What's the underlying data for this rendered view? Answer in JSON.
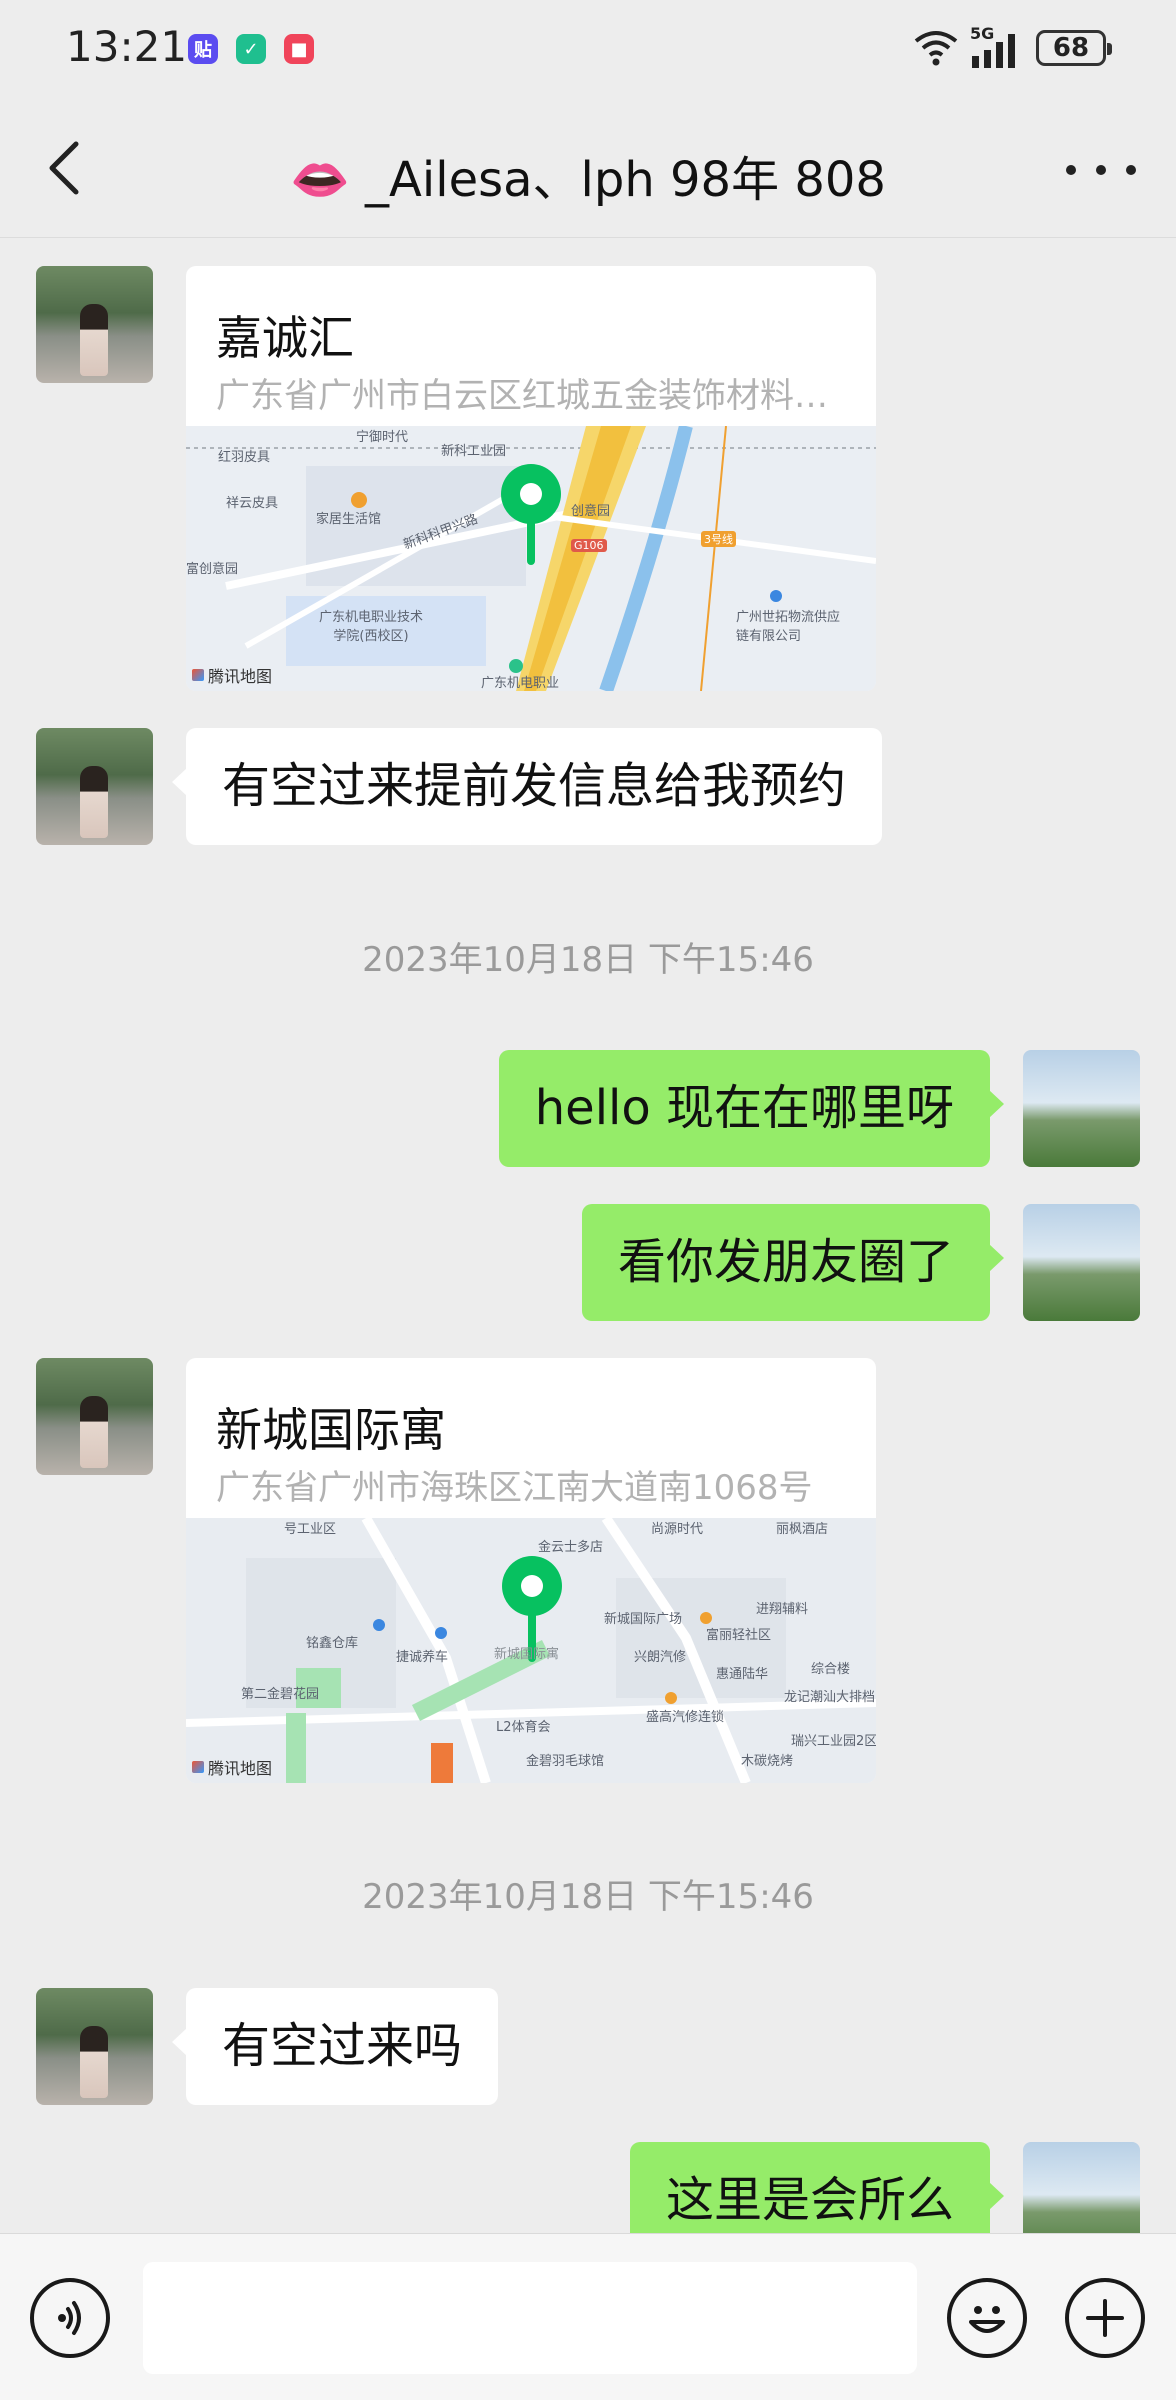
{
  "status_bar": {
    "time": "13:21",
    "app_icons": [
      {
        "name": "tieba-app-icon",
        "glyph": "贴",
        "color": "#5b4cf0"
      },
      {
        "name": "shield-app-icon",
        "glyph": "✓",
        "color": "#1fbf8f"
      },
      {
        "name": "red-app-icon",
        "glyph": "■",
        "color": "#f0445a"
      }
    ],
    "network": "5G",
    "battery": "68"
  },
  "header": {
    "title": "👄 _Ailesa、lph 98年 808"
  },
  "messages": [
    {
      "type": "location",
      "side": "left",
      "name": "嘉诚汇",
      "address": "广东省广州市白云区红城五金装饰材料…",
      "map_brand": "腾讯地图",
      "map_labels": [
        "宁御时代",
        "新科工业园",
        "红羽皮具",
        "祥云皮具",
        "家居生活馆",
        "创意园",
        "G106",
        "新科科甲兴路",
        "富创意园",
        "广东机电职业技术学院(西校区)",
        "广州世拓物流供应链有限公司",
        "广东机电职业",
        "3号线"
      ]
    },
    {
      "type": "text",
      "side": "left",
      "text": "有空过来提前发信息给我预约"
    },
    {
      "type": "timestamp",
      "text": "2023年10月18日 下午15:46"
    },
    {
      "type": "text",
      "side": "right",
      "text": "hello  现在在哪里呀"
    },
    {
      "type": "text",
      "side": "right",
      "text": "看你发朋友圈了"
    },
    {
      "type": "location",
      "side": "left",
      "name": "新城国际寓",
      "address": "广东省广州市海珠区江南大道南1068号",
      "map_brand": "腾讯地图",
      "map_labels": [
        "号工业区",
        "尚源时代",
        "丽枫酒店",
        "金云士多店",
        "新城国际广场",
        "进翔辅料",
        "铭鑫仓库",
        "捷诚养车",
        "兴朗汽修",
        "富丽轻社区",
        "综合楼",
        "惠通陆华",
        "龙记潮汕大排档",
        "盛高汽修连锁",
        "瑞兴工业园2区",
        "L2体育会",
        "木碳烧烤",
        "金碧羽毛球馆",
        "第二金碧花园",
        "新城国际寓"
      ]
    },
    {
      "type": "timestamp",
      "text": "2023年10月18日 下午15:46"
    },
    {
      "type": "text",
      "side": "left",
      "text": "有空过来吗"
    },
    {
      "type": "text",
      "side": "right",
      "text": "这里是会所么"
    }
  ],
  "input_bar": {
    "placeholder": ""
  }
}
